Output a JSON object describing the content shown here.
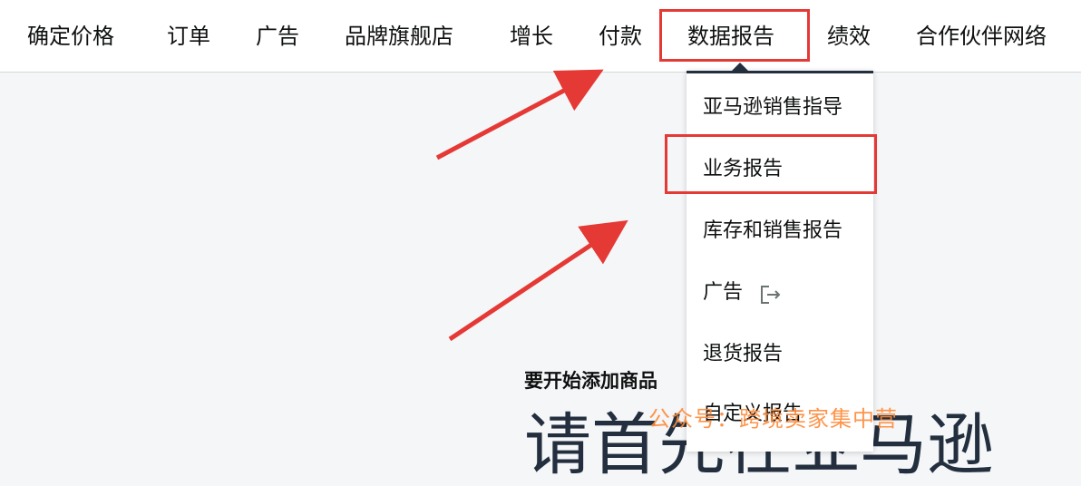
{
  "topnav": {
    "items": [
      "确定价格",
      "订单",
      "广告",
      "品牌旗舰店",
      "增长",
      "付款",
      "数据报告",
      "绩效",
      "合作伙伴网络"
    ],
    "active_item": "数据报告"
  },
  "dropdown": {
    "items": [
      "亚马逊销售指导",
      "业务报告",
      "库存和销售报告",
      "广告",
      "退货报告",
      "自定义报告"
    ],
    "highlighted_item": "业务报告",
    "external_icon": "external-link-icon"
  },
  "main": {
    "heading": "要开始添加商品",
    "big_text": "请首先在亚马逊"
  },
  "watermark": "公众号：跨境卖家集中营",
  "colors": {
    "annotation_red": "#e53935",
    "watermark_orange": "#ff8c3b",
    "nav_dark": "#232f3e"
  }
}
